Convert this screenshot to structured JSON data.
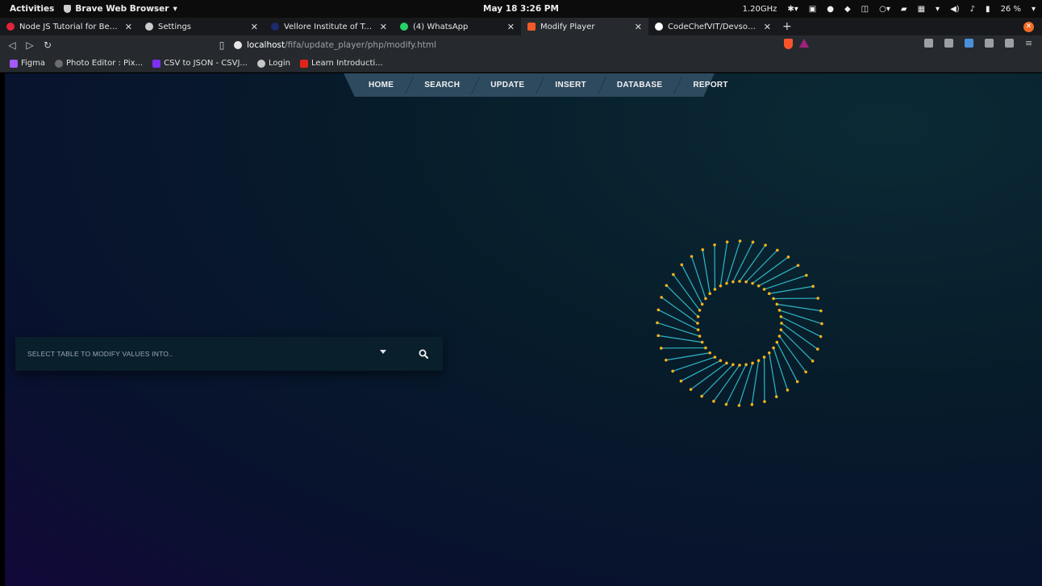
{
  "topbar": {
    "activities": "Activities",
    "app_name": "Brave Web Browser",
    "clock": "May 18  3:26 PM",
    "cpu": "1.20GHz",
    "battery": "26 %"
  },
  "tabs": [
    {
      "title": "Node JS Tutorial for Beginners",
      "favicon_color": "#e0243b"
    },
    {
      "title": "Settings",
      "favicon_color": "#cccccc"
    },
    {
      "title": "Vellore Institute of Technology",
      "favicon_color": "#1d2a6b"
    },
    {
      "title": "(4) WhatsApp",
      "favicon_color": "#25d366"
    },
    {
      "title": "Modify Player",
      "favicon_color": "#f05a28",
      "active": true
    },
    {
      "title": "CodeChefVIT/DevsocApp",
      "favicon_color": "#ffffff"
    }
  ],
  "toolbar": {
    "url_host": "localhost",
    "url_path": "/fifa/update_player/php/modify.html"
  },
  "bookmarks": [
    {
      "label": "Figma",
      "color": "#a259ff"
    },
    {
      "label": "Photo Editor : Pix...",
      "color": "#6c6c6c"
    },
    {
      "label": "CSV to JSON - CSVJ...",
      "color": "#7b2ff7"
    },
    {
      "label": "Login",
      "color": "#c7c7c7"
    },
    {
      "label": "Learn Introducti...",
      "color": "#e2231a"
    }
  ],
  "page": {
    "nav": [
      "HOME",
      "SEARCH",
      "UPDATE",
      "INSERT",
      "DATABASE",
      "REPORT"
    ],
    "select_placeholder": "SELECT TABLE TO MODIFY VALUES INTO..",
    "colors": {
      "nav_bg": "#2e4a5f",
      "spinner_line": "#2fb7c4",
      "spinner_dot": "#f5b21b"
    }
  }
}
